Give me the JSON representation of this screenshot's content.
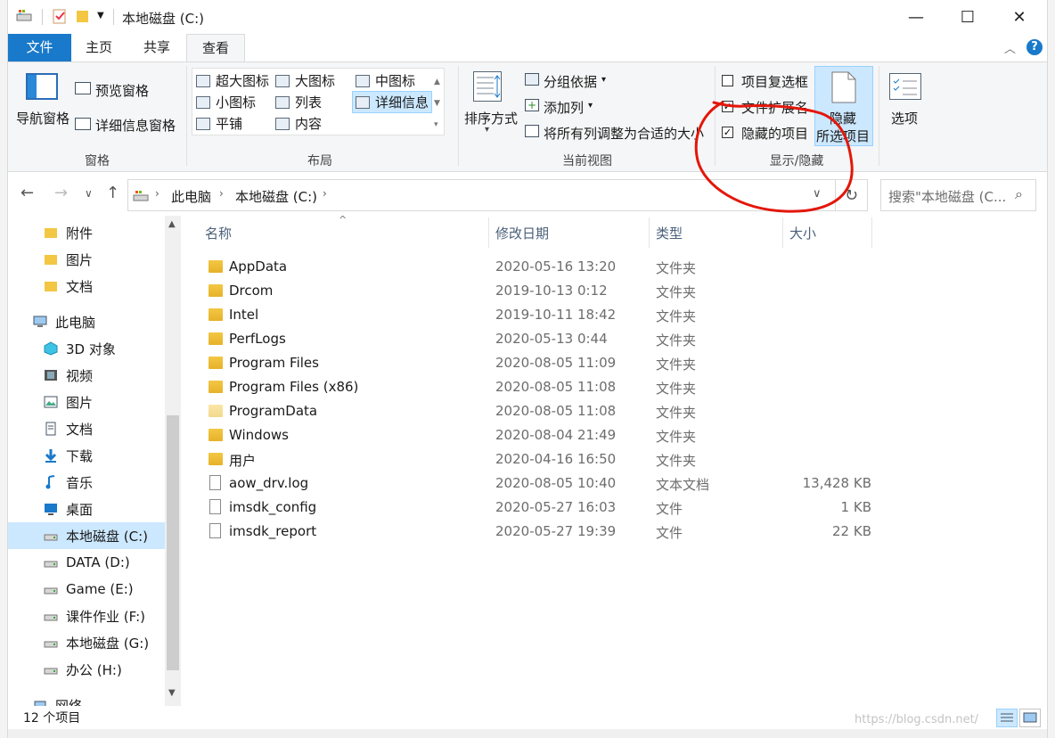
{
  "window": {
    "title": "本地磁盘 (C:)",
    "controls": {
      "minimize": "—",
      "maximize": "☐",
      "close": "✕"
    }
  },
  "ribbon": {
    "tabs": [
      {
        "label": "文件"
      },
      {
        "label": "主页"
      },
      {
        "label": "共享"
      },
      {
        "label": "查看"
      }
    ],
    "groups": {
      "panes": {
        "label": "窗格",
        "nav_pane": "导航窗格",
        "preview_pane": "预览窗格",
        "details_pane": "详细信息窗格"
      },
      "layout": {
        "label": "布局",
        "items": [
          "超大图标",
          "大图标",
          "中图标",
          "小图标",
          "列表",
          "详细信息",
          "平铺",
          "内容"
        ],
        "selected": "详细信息"
      },
      "current_view": {
        "label": "当前视图",
        "sort_by": "排序方式",
        "group_by": "分组依据",
        "add_column": "添加列",
        "size_all_columns": "将所有列调整为合适的大小"
      },
      "show_hide": {
        "label": "显示/隐藏",
        "item_checkboxes": "项目复选框",
        "file_extensions": "文件扩展名",
        "hidden_items": "隐藏的项目",
        "hide_selected_line1": "隐藏",
        "hide_selected_line2": "所选项目",
        "item_checkboxes_checked": false,
        "file_extensions_checked": true,
        "hidden_items_checked": true
      },
      "options": {
        "label": "选项"
      }
    }
  },
  "addressbar": {
    "crumbs": [
      "此电脑",
      "本地磁盘 (C:)"
    ],
    "search_placeholder": "搜索\"本地磁盘 (C..."
  },
  "navpane": {
    "items": [
      {
        "label": "附件",
        "icon": "folder-icon"
      },
      {
        "label": "图片",
        "icon": "folder-icon"
      },
      {
        "label": "文档",
        "icon": "folder-icon"
      },
      {
        "label": "此电脑",
        "icon": "computer-icon"
      },
      {
        "label": "3D 对象",
        "icon": "cube-icon"
      },
      {
        "label": "视频",
        "icon": "film-icon"
      },
      {
        "label": "图片",
        "icon": "picture-icon"
      },
      {
        "label": "文档",
        "icon": "document-icon"
      },
      {
        "label": "下载",
        "icon": "download-icon"
      },
      {
        "label": "音乐",
        "icon": "music-icon"
      },
      {
        "label": "桌面",
        "icon": "desktop-icon"
      },
      {
        "label": "本地磁盘 (C:)",
        "icon": "drive-icon"
      },
      {
        "label": "DATA (D:)",
        "icon": "drive-icon"
      },
      {
        "label": "Game (E:)",
        "icon": "drive-icon"
      },
      {
        "label": "课件作业 (F:)",
        "icon": "drive-icon"
      },
      {
        "label": "本地磁盘 (G:)",
        "icon": "drive-icon"
      },
      {
        "label": "办公 (H:)",
        "icon": "drive-icon"
      },
      {
        "label": "网络",
        "icon": "network-icon"
      }
    ],
    "selected": "本地磁盘 (C:)"
  },
  "filelist": {
    "columns": [
      "名称",
      "修改日期",
      "类型",
      "大小"
    ],
    "rows": [
      {
        "name": "AppData",
        "date": "2020-05-16 13:20",
        "type": "文件夹",
        "size": "",
        "kind": "folder"
      },
      {
        "name": "Drcom",
        "date": "2019-10-13 0:12",
        "type": "文件夹",
        "size": "",
        "kind": "folder"
      },
      {
        "name": "Intel",
        "date": "2019-10-11 18:42",
        "type": "文件夹",
        "size": "",
        "kind": "folder"
      },
      {
        "name": "PerfLogs",
        "date": "2020-05-13 0:44",
        "type": "文件夹",
        "size": "",
        "kind": "folder"
      },
      {
        "name": "Program Files",
        "date": "2020-08-05 11:09",
        "type": "文件夹",
        "size": "",
        "kind": "folder"
      },
      {
        "name": "Program Files (x86)",
        "date": "2020-08-05 11:08",
        "type": "文件夹",
        "size": "",
        "kind": "folder"
      },
      {
        "name": "ProgramData",
        "date": "2020-08-05 11:08",
        "type": "文件夹",
        "size": "",
        "kind": "folder-hidden"
      },
      {
        "name": "Windows",
        "date": "2020-08-04 21:49",
        "type": "文件夹",
        "size": "",
        "kind": "folder"
      },
      {
        "name": "用户",
        "date": "2020-04-16 16:50",
        "type": "文件夹",
        "size": "",
        "kind": "folder"
      },
      {
        "name": "aow_drv.log",
        "date": "2020-08-05 10:40",
        "type": "文本文档",
        "size": "13,428 KB",
        "kind": "file"
      },
      {
        "name": "imsdk_config",
        "date": "2020-05-27 16:03",
        "type": "文件",
        "size": "1 KB",
        "kind": "file"
      },
      {
        "name": "imsdk_report",
        "date": "2020-05-27 19:39",
        "type": "文件",
        "size": "22 KB",
        "kind": "file"
      }
    ]
  },
  "statusbar": {
    "item_count": "12 个项目"
  },
  "watermark": "https://blog.csdn.net/",
  "colors": {
    "accent": "#1979ca",
    "selection": "#cce8ff",
    "annotation": "#e3170a"
  }
}
